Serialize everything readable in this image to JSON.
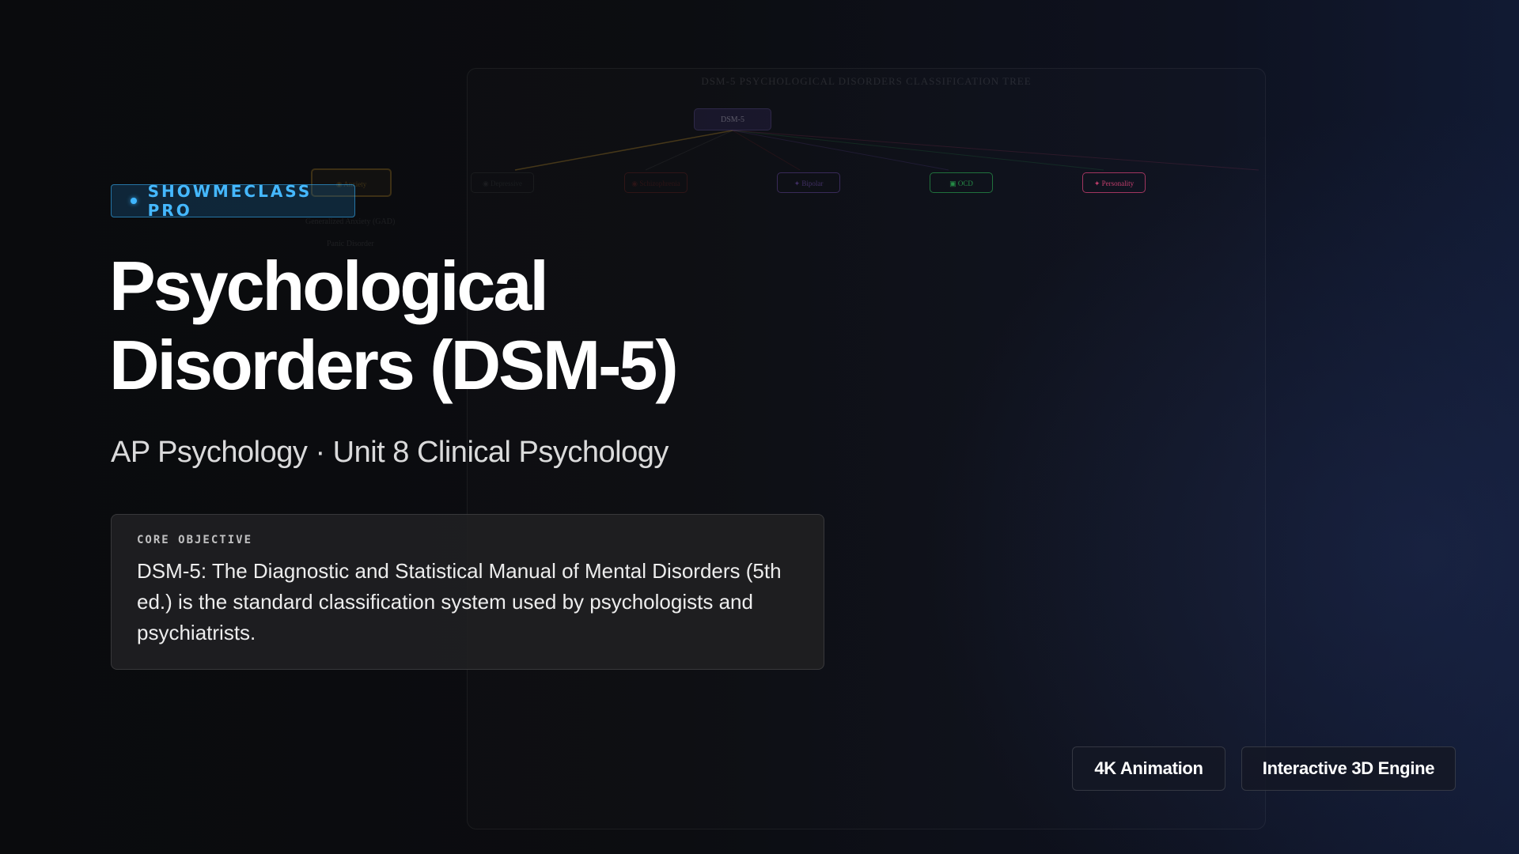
{
  "badge": {
    "label": "SHOWMECLASS PRO"
  },
  "hero": {
    "title_line_1": "Psychological",
    "title_line_2": "Disorders (DSM-5)",
    "subtitle": "AP Psychology · Unit 8 Clinical Psychology"
  },
  "objective": {
    "label": "CORE OBJECTIVE",
    "text": "DSM-5: The Diagnostic and Statistical Manual of Mental Disorders (5th ed.) is the standard classification system used by psychologists and psychiatrists."
  },
  "diagram": {
    "title": "DSM-5 PSYCHOLOGICAL DISORDERS CLASSIFICATION TREE",
    "root": "DSM-5",
    "categories": [
      {
        "label": "Anxiety",
        "color": "#d6a12a"
      },
      {
        "label": "Depressive",
        "color": "#6b6b6b"
      },
      {
        "label": "Schizophrenia",
        "color": "#c8342e"
      },
      {
        "label": "Bipolar",
        "color": "#8a5cd6"
      },
      {
        "label": "OCD",
        "color": "#2fbf5a"
      },
      {
        "label": "Personality",
        "color": "#e0457a"
      }
    ],
    "anxiety_subtypes": [
      "Generalized Anxiety (GAD)",
      "Panic Disorder"
    ]
  },
  "features": {
    "animation": "4K Animation",
    "engine": "Interactive 3D Engine"
  },
  "colors": {
    "accent": "#45b8ff",
    "background": "#0b0c0f"
  }
}
